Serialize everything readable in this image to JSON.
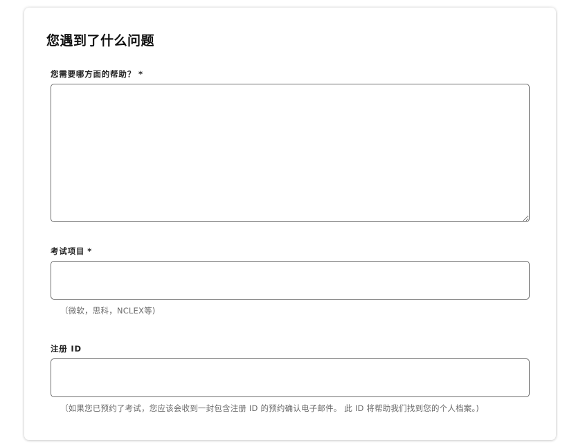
{
  "form": {
    "title": "您遇到了什么问题",
    "help_field": {
      "label": "您需要哪方面的帮助？",
      "required_mark": "*",
      "value": ""
    },
    "exam_field": {
      "label": "考试项目",
      "required_mark": "*",
      "value": "",
      "hint": "（微软，思科，NCLEX等)"
    },
    "registration_field": {
      "label": "注册 ID",
      "value": "",
      "hint": "（如果您已预约了考试，您应该会收到一封包含注册 ID 的预约确认电子邮件。 此 ID 将帮助我们找到您的个人档案。)"
    }
  }
}
